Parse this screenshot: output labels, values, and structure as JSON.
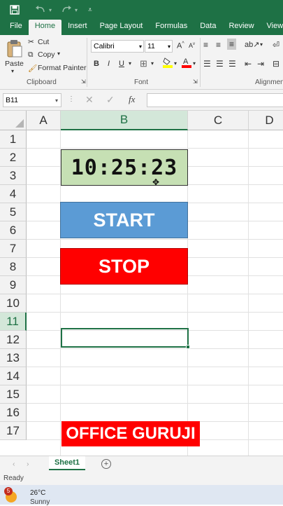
{
  "colors": {
    "brand": "#1e7145",
    "timer_bg": "#c6e0b4",
    "start_bg": "#5b9bd5",
    "stop_bg": "#ff0000",
    "label_bg": "#ff0000"
  },
  "titlebar": {
    "icons": [
      "save-icon",
      "undo-icon",
      "redo-icon",
      "customize-icon"
    ]
  },
  "menu": {
    "tabs": [
      "File",
      "Home",
      "Insert",
      "Page Layout",
      "Formulas",
      "Data",
      "Review",
      "View"
    ],
    "active": "Home"
  },
  "ribbon": {
    "paste": "Paste",
    "cut": "Cut",
    "copy": "Copy",
    "format_painter": "Format Painter",
    "clipboard_label": "Clipboard",
    "font_name": "Calibri",
    "font_size": "11",
    "bold": "B",
    "italic": "I",
    "underline": "U",
    "font_label": "Font",
    "alignment_label": "Alignment"
  },
  "formula_bar": {
    "name_box": "B11",
    "fx": "fx",
    "value": ""
  },
  "grid": {
    "columns": [
      "A",
      "B",
      "C",
      "D"
    ],
    "selected_column": "B",
    "rows": [
      "1",
      "2",
      "3",
      "4",
      "5",
      "6",
      "7",
      "8",
      "9",
      "10",
      "11",
      "12",
      "13",
      "14",
      "15",
      "16",
      "17"
    ],
    "selected_row": "11"
  },
  "shapes": {
    "timer": "10:25:23",
    "start": "START",
    "stop": "STOP",
    "brand_label": "OFFICE GURUJI"
  },
  "sheets": {
    "tabs": [
      "Sheet1"
    ]
  },
  "status": {
    "text": "Ready"
  },
  "taskbar": {
    "weather_temp": "26°C",
    "weather_desc": "Sunny",
    "badge": "5"
  }
}
